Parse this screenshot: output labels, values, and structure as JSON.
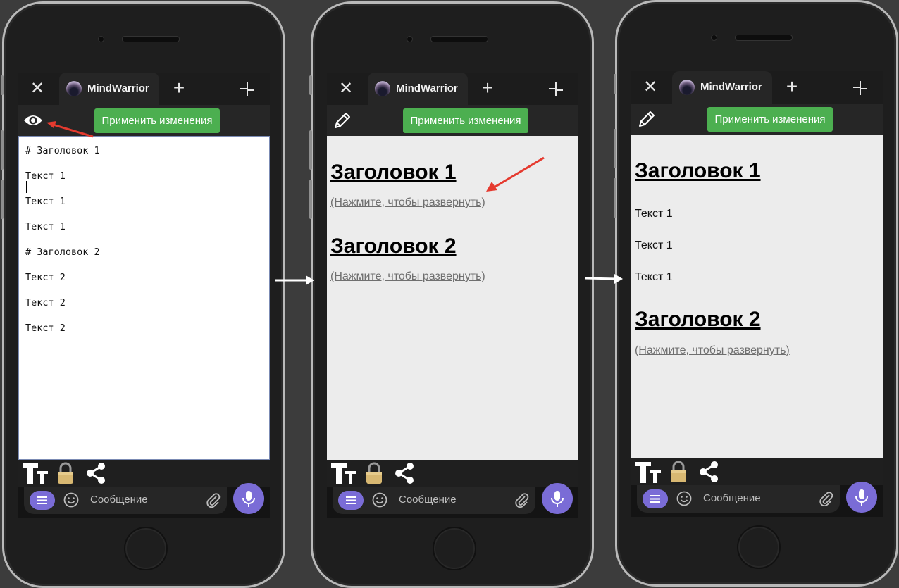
{
  "colors": {
    "background": "#3c3c3c",
    "apply_button": "#4caf50",
    "accent_purple": "#7a6cd6",
    "annotation_arrow": "#e53a2f",
    "flow_arrow": "#ffffff"
  },
  "common": {
    "tab_name": "MindWarrior",
    "apply_label": "Применить изменения",
    "message_placeholder": "Сообщение",
    "icons": [
      "close-icon",
      "plus-icon",
      "minimize-icon",
      "text-format-icon",
      "lock-icon",
      "share-icon",
      "menu-icon",
      "emoji-icon",
      "paperclip-icon",
      "microphone-icon"
    ]
  },
  "phone1": {
    "mode_icon": "eye-icon",
    "editor_lines": [
      "# Заголовок 1",
      "Текст 1",
      "Текст 1",
      "Текст 1",
      "# Заголовок 2",
      "Текст 2",
      "Текст 2",
      "Текст 2"
    ]
  },
  "phone2": {
    "mode_icon": "pencil-icon",
    "heading1": "Заголовок 1",
    "expand1": "(Нажмите, чтобы развернуть)",
    "heading2": "Заголовок 2",
    "expand2": "(Нажмите, чтобы развернуть)"
  },
  "phone3": {
    "mode_icon": "pencil-icon",
    "heading1": "Заголовок 1",
    "texts": [
      "Текст 1",
      "Текст 1",
      "Текст 1"
    ],
    "heading2": "Заголовок 2",
    "expand2": "(Нажмите, чтобы развернуть)"
  }
}
